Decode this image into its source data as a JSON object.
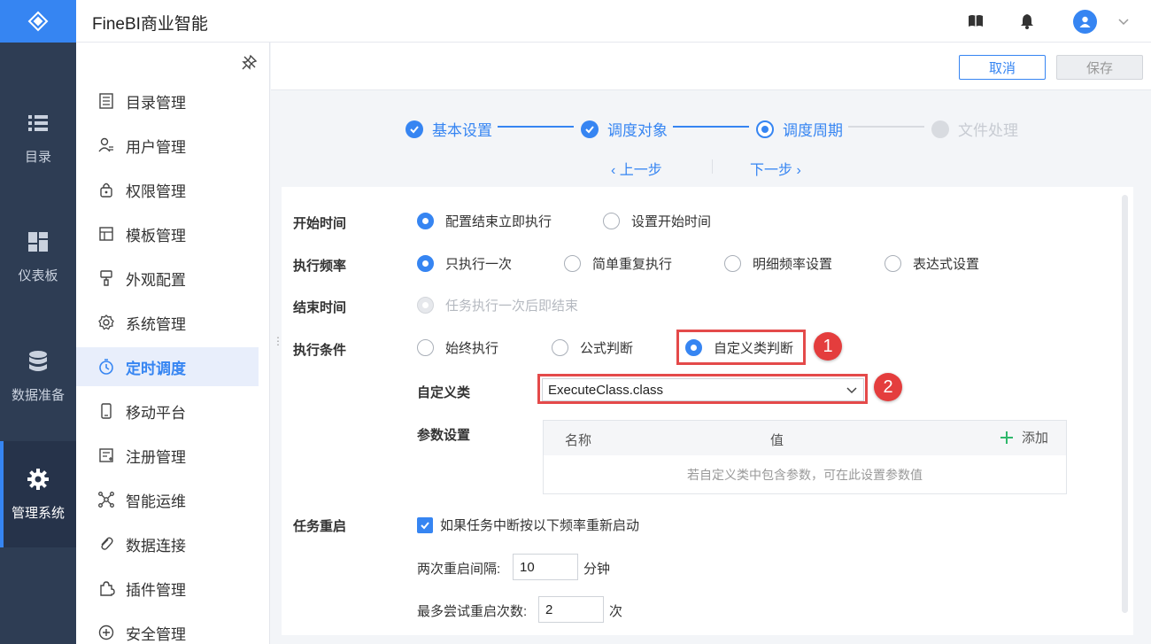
{
  "header": {
    "title": "FineBI商业智能"
  },
  "rail": [
    {
      "label": "目录",
      "icon": "list-icon"
    },
    {
      "label": "仪表板",
      "icon": "dashboard-icon"
    },
    {
      "label": "数据准备",
      "icon": "database-icon"
    },
    {
      "label": "管理系统",
      "icon": "gear-icon"
    }
  ],
  "sidebar": {
    "items": [
      {
        "label": "目录管理",
        "icon": "directory-icon"
      },
      {
        "label": "用户管理",
        "icon": "user-icon"
      },
      {
        "label": "权限管理",
        "icon": "lock-icon"
      },
      {
        "label": "模板管理",
        "icon": "template-icon"
      },
      {
        "label": "外观配置",
        "icon": "brush-icon"
      },
      {
        "label": "系统管理",
        "icon": "settings-icon"
      },
      {
        "label": "定时调度",
        "icon": "timer-icon"
      },
      {
        "label": "移动平台",
        "icon": "mobile-icon"
      },
      {
        "label": "注册管理",
        "icon": "register-icon"
      },
      {
        "label": "智能运维",
        "icon": "ops-icon"
      },
      {
        "label": "数据连接",
        "icon": "link-icon"
      },
      {
        "label": "插件管理",
        "icon": "plugin-icon"
      },
      {
        "label": "安全管理",
        "icon": "shield-icon"
      }
    ],
    "active_index": 6
  },
  "toolbar": {
    "cancel_label": "取消",
    "save_label": "保存"
  },
  "steps": [
    {
      "label": "基本设置",
      "state": "done"
    },
    {
      "label": "调度对象",
      "state": "done"
    },
    {
      "label": "调度周期",
      "state": "current"
    },
    {
      "label": "文件处理",
      "state": "pending"
    }
  ],
  "nav": {
    "prev_label": "上一步",
    "next_label": "下一步"
  },
  "form": {
    "start_time": {
      "label": "开始时间",
      "options": [
        "配置结束立即执行",
        "设置开始时间"
      ],
      "selected": 0
    },
    "frequency": {
      "label": "执行频率",
      "options": [
        "只执行一次",
        "简单重复执行",
        "明细频率设置",
        "表达式设置"
      ],
      "selected": 0
    },
    "end_time": {
      "label": "结束时间",
      "options": [
        "任务执行一次后即结束"
      ]
    },
    "condition": {
      "label": "执行条件",
      "options": [
        "始终执行",
        "公式判断",
        "自定义类判断"
      ],
      "selected": 2
    },
    "custom_class": {
      "label": "自定义类",
      "value": "ExecuteClass.class"
    },
    "params": {
      "label": "参数设置",
      "col_name": "名称",
      "col_value": "值",
      "add_label": "添加",
      "empty_text": "若自定义类中包含参数，可在此设置参数值"
    },
    "restart": {
      "label": "任务重启",
      "checkbox_label": "如果任务中断按以下频率重新启动",
      "checked": true,
      "interval_label": "两次重启间隔:",
      "interval_value": "10",
      "interval_unit": "分钟",
      "max_label": "最多尝试重启次数:",
      "max_value": "2",
      "max_unit": "次"
    }
  },
  "annotations": {
    "badge1": "1",
    "badge2": "2"
  },
  "colors": {
    "accent": "#3685f2",
    "rail": "#2e3d54",
    "annotation": "#e44a4a"
  }
}
